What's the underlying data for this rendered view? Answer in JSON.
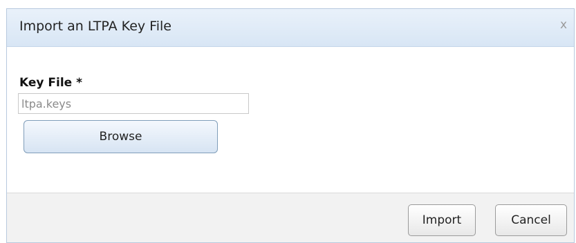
{
  "dialog": {
    "title": "Import an LTPA Key File",
    "close_glyph": "x",
    "close_icon": "close-icon"
  },
  "form": {
    "key_file_label": "Key File *",
    "key_file_value": "",
    "key_file_placeholder": "ltpa.keys",
    "browse_label": "Browse"
  },
  "footer": {
    "import_label": "Import",
    "cancel_label": "Cancel"
  },
  "colors": {
    "title_bar": "#dde9f6",
    "dialog_border": "#b7c9de",
    "footer_bg": "#f2f2f2",
    "browse_button_bg": "#e3ecf7"
  }
}
